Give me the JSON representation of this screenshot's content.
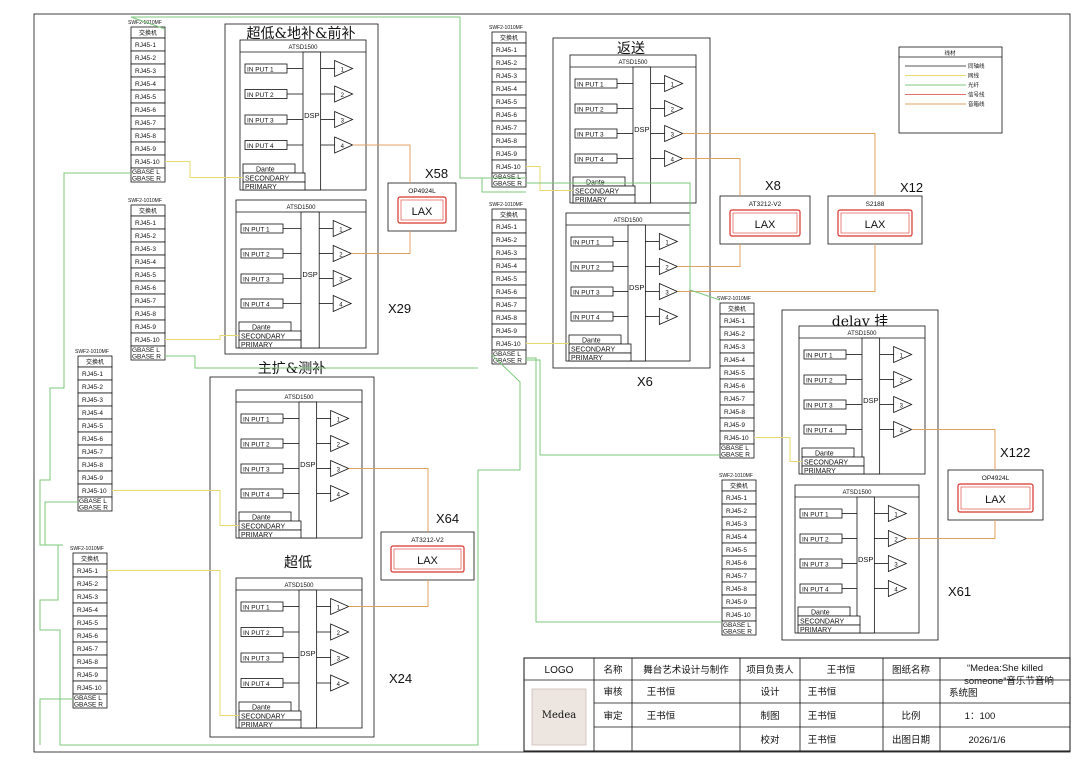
{
  "switch_label": "交换机",
  "switch_models": [
    "SWF2-1010MF",
    "SWF2-1010MF",
    "SWF2-1010MF",
    "SWF2-1010MF",
    "SWF2-1010MF",
    "SWF2-1010MF",
    "SWF2-1010MF",
    "SWF2-1010MF"
  ],
  "ports": [
    "RJ45-1",
    "RJ45-2",
    "RJ45-3",
    "RJ45-4",
    "RJ45-5",
    "RJ45-6",
    "RJ45-7",
    "RJ45-8",
    "RJ45-9",
    "RJ45-10"
  ],
  "gbase": [
    "GBASE L",
    "GBASE R"
  ],
  "dsp": {
    "model": "ATSD1500",
    "dsp_label": "DSP",
    "inputs": [
      "IN PUT 1",
      "IN PUT 2",
      "IN PUT 3",
      "IN PUT 4"
    ],
    "outputs": [
      "1",
      "2",
      "3",
      "4"
    ],
    "dante": "Dante",
    "secondary": "SECONDARY",
    "primary": "PRIMARY"
  },
  "groups": {
    "g1": "超低&地补&前补",
    "g2": "返送",
    "g3": "delay 挂",
    "g4": "主扩&测补",
    "g5": "超低"
  },
  "zones": [
    "X29",
    "X6",
    "X61",
    "X24"
  ],
  "amps": [
    {
      "id": "X58",
      "model": "OP4924L",
      "brand": "LAX"
    },
    {
      "id": "X8",
      "model": "AT3212-V2",
      "brand": "LAX"
    },
    {
      "id": "X12",
      "model": "S2188",
      "brand": "LAX"
    },
    {
      "id": "X122",
      "model": "OP4924L",
      "brand": "LAX"
    },
    {
      "id": "X64",
      "model": "AT3212-V2",
      "brand": "LAX"
    }
  ],
  "legend": {
    "title": "线材",
    "items": [
      {
        "label": "同轴线",
        "color": "#555555"
      },
      {
        "label": "网线",
        "color": "#e8d870"
      },
      {
        "label": "光纤",
        "color": "#7cc87c"
      },
      {
        "label": "信号线",
        "color": "#e27070"
      },
      {
        "label": "音箱线",
        "color": "#e0a060"
      }
    ]
  },
  "colors": {
    "ethernet": "#e8d870",
    "fiber": "#7cc87c",
    "signal": "#e27070",
    "speaker": "#e0a060",
    "lax": "#d9342b"
  },
  "title_block": {
    "logo": "LOGO",
    "logo_text": "Medea",
    "name_label": "名称",
    "name_value": "舞台艺术设计与制作",
    "pm_label": "项目负责人",
    "pm_value": "王书恒",
    "dwg_label": "图纸名称",
    "dwg_value_1": "“Medea:She killed",
    "dwg_value_2": "someone”音乐节音响",
    "dwg_value_3": "系统图",
    "review_label": "审核",
    "review_value": "王书恒",
    "design_label": "设计",
    "design_value": "王书恒",
    "approve_label": "审定",
    "approve_value": "王书恒",
    "draw_label": "制图",
    "draw_value": "王书恒",
    "scale_label": "比例",
    "scale_value": "1：100",
    "check_label": "校对",
    "check_value": "王书恒",
    "date_label": "出图日期",
    "date_value": "2026/1/6"
  }
}
